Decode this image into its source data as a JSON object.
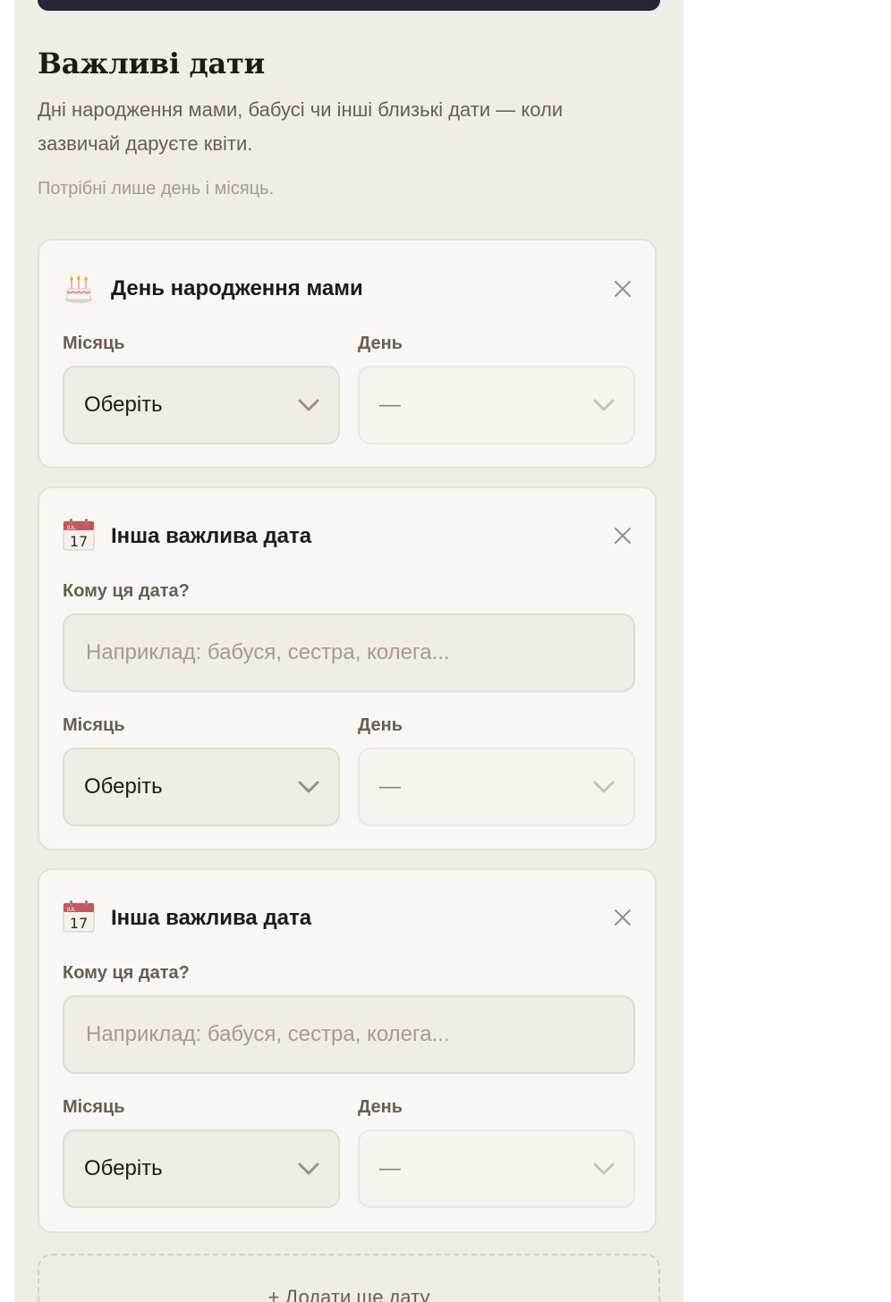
{
  "section": {
    "title": "Важливі дати",
    "description": "Дні народження мами, бабусі чи інші близькі дати — коли зазвичай даруєте квіти.",
    "hint": "Потрібні лише день і місяць."
  },
  "cards": [
    {
      "icon": "birthday-cake-icon",
      "title": "День народження мами",
      "month_label": "Місяць",
      "month_value": "Оберіть",
      "day_label": "День",
      "day_value": "—"
    },
    {
      "icon": "calendar-icon",
      "calendar_month": "JUL",
      "calendar_day": "17",
      "title": "Інша важлива дата",
      "who_label": "Кому ця дата?",
      "who_placeholder": "Наприклад: бабуся, сестра, колега...",
      "month_label": "Місяць",
      "month_value": "Оберіть",
      "day_label": "День",
      "day_value": "—"
    },
    {
      "icon": "calendar-icon",
      "calendar_month": "JUL",
      "calendar_day": "17",
      "title": "Інша важлива дата",
      "who_label": "Кому ця дата?",
      "who_placeholder": "Наприклад: бабуся, сестра, колега...",
      "month_label": "Місяць",
      "month_value": "Оберіть",
      "day_label": "День",
      "day_value": "—"
    }
  ],
  "add_button": {
    "label": "+ Додати ще дату"
  },
  "colors": {
    "panel_bg": "#f0ede6",
    "card_bg": "#f8f7f3",
    "top_bar": "#2a2235",
    "text_primary": "#1f1a17",
    "text_secondary": "#6b5d52",
    "text_muted": "#a89a8c"
  }
}
